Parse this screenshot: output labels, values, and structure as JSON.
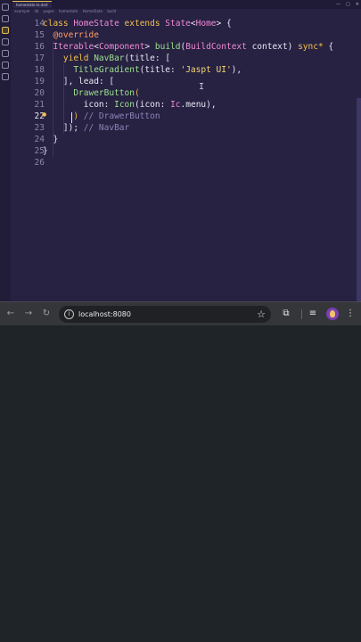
{
  "editor": {
    "tab_label": "homestate.ts.dart",
    "breadcrumb": [
      "example",
      "lib",
      "pages",
      "homestate",
      "HomeState",
      "build"
    ],
    "window_controls": [
      "—",
      "▢",
      "✕"
    ],
    "lines": [
      {
        "num": "14",
        "tokens": [
          [
            "kw",
            "class "
          ],
          [
            "cls",
            "HomeState "
          ],
          [
            "kw",
            "extends "
          ],
          [
            "cls",
            "State"
          ],
          [
            "punc",
            "<"
          ],
          [
            "cls",
            "Home"
          ],
          [
            "punc",
            "> {"
          ]
        ]
      },
      {
        "num": "15",
        "tokens": [
          [
            "ann",
            "  @override"
          ]
        ]
      },
      {
        "num": "16",
        "tokens": [
          [
            "cls",
            "  Iterable"
          ],
          [
            "punc",
            "<"
          ],
          [
            "cls",
            "Component"
          ],
          [
            "punc",
            "> "
          ],
          [
            "fn",
            "build"
          ],
          [
            "punc",
            "("
          ],
          [
            "cls",
            "BuildContext "
          ],
          [
            "param",
            "context"
          ],
          [
            "punc",
            ") "
          ],
          [
            "kw",
            "sync* "
          ],
          [
            "punc",
            "{"
          ]
        ]
      },
      {
        "num": "17",
        "tokens": [
          [
            "kw",
            "    yield "
          ],
          [
            "fn",
            "NavBar"
          ],
          [
            "punc",
            "("
          ],
          [
            "param",
            "title"
          ],
          [
            "punc",
            ": ["
          ]
        ]
      },
      {
        "num": "18",
        "tokens": [
          [
            "fn",
            "      TitleGradient"
          ],
          [
            "punc",
            "("
          ],
          [
            "param",
            "title"
          ],
          [
            "punc",
            ": "
          ],
          [
            "str",
            "'Jaspt UI'"
          ],
          [
            "punc",
            "),"
          ]
        ]
      },
      {
        "num": "19",
        "tokens": [
          [
            "punc",
            "    ], "
          ],
          [
            "param",
            "lead"
          ],
          [
            "punc",
            ": ["
          ]
        ]
      },
      {
        "num": "20",
        "tokens": [
          [
            "fn",
            "      DrawerButton"
          ],
          [
            "paren",
            "("
          ]
        ]
      },
      {
        "num": "21",
        "tokens": [
          [
            "param",
            "        icon"
          ],
          [
            "punc",
            ": "
          ],
          [
            "fn",
            "Icon"
          ],
          [
            "punc",
            "("
          ],
          [
            "param",
            "icon"
          ],
          [
            "punc",
            ": "
          ],
          [
            "cls",
            "Ic"
          ],
          [
            "punc",
            "."
          ],
          [
            "ident",
            "menu"
          ],
          [
            "punc",
            "),"
          ]
        ]
      },
      {
        "num": "22",
        "tokens": [
          [
            "paren",
            "      )"
          ],
          [
            "cmt",
            " // DrawerButton"
          ]
        ]
      },
      {
        "num": "23",
        "tokens": [
          [
            "punc",
            "    ]); "
          ],
          [
            "cmt",
            "// NavBar"
          ]
        ]
      },
      {
        "num": "24",
        "tokens": [
          [
            "punc",
            "  }"
          ]
        ]
      },
      {
        "num": "25",
        "tokens": [
          [
            "punc",
            "}"
          ]
        ]
      },
      {
        "num": "26",
        "tokens": []
      }
    ],
    "current_line": "22"
  },
  "browser": {
    "url": "localhost:8080",
    "icons": {
      "back": "arrow-left-icon",
      "forward": "arrow-right-icon",
      "reload": "reload-icon",
      "info": "info-icon",
      "bookmark": "star-icon",
      "extensions": "puzzle-icon",
      "media": "media-controls-icon",
      "profile": "avatar",
      "menu": "kebab-menu-icon"
    }
  }
}
